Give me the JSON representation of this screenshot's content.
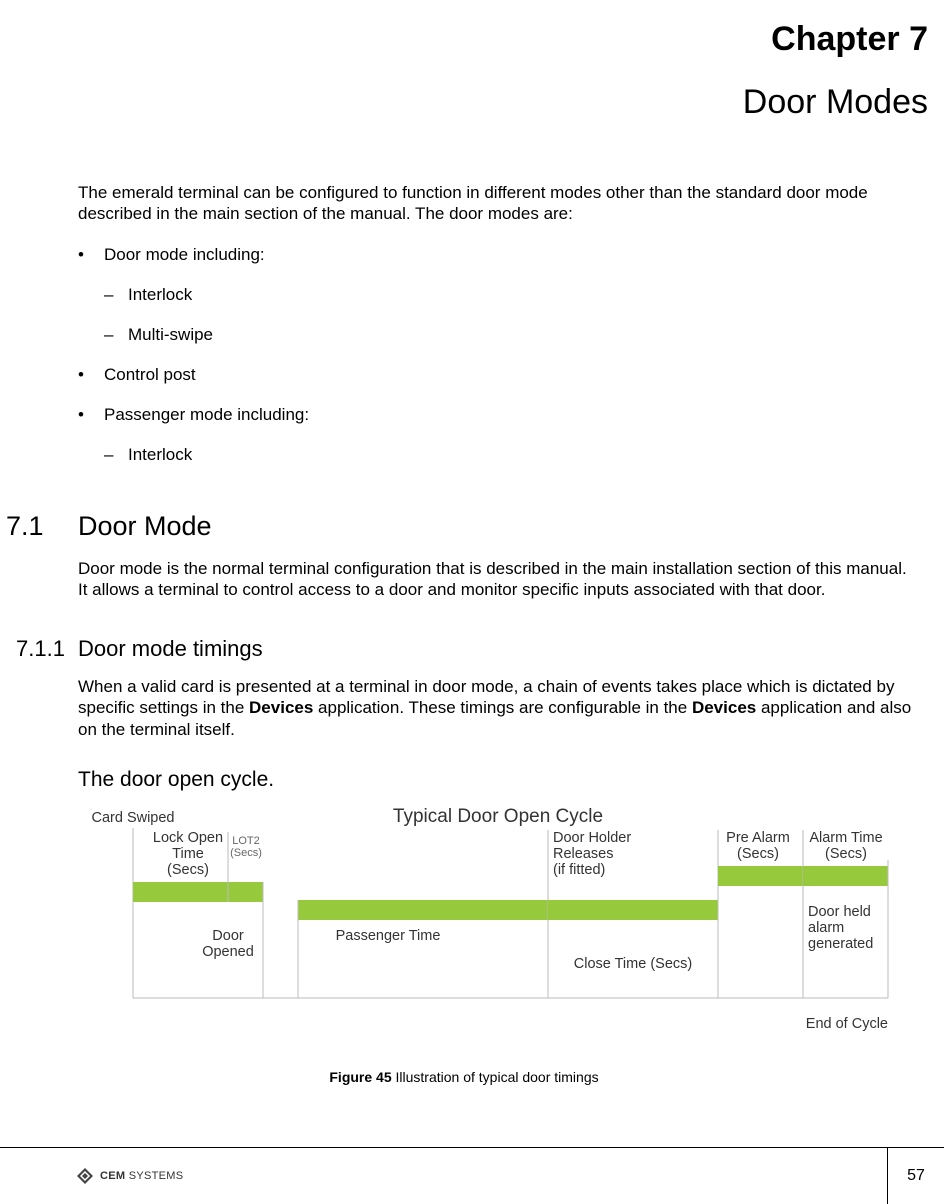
{
  "chapter": {
    "label": "Chapter 7",
    "title": "Door Modes"
  },
  "intro": "The emerald terminal can be configured to function in different modes other than the standard door mode described in the main section of the manual. The door modes are:",
  "bullets": {
    "b1": "Door mode including:",
    "b1a": "Interlock",
    "b1b": "Multi-swipe",
    "b2": "Control post",
    "b3": "Passenger mode including:",
    "b3a": "Interlock"
  },
  "section71": {
    "num": "7.1",
    "title": "Door Mode",
    "body": "Door mode is the normal terminal configuration that is described in the main installation section of this manual. It allows a terminal to control access to a door and monitor specific inputs associated with that door."
  },
  "section711": {
    "num": "7.1.1",
    "title": "Door mode timings",
    "body_pre": "When a valid card is presented at a terminal in door mode, a chain of events takes place which is dictated by specific settings in the ",
    "body_bold1": "Devices",
    "body_mid": " application. These timings are configurable in the ",
    "body_bold2": "Devices",
    "body_post": " application and also on the terminal itself."
  },
  "subhead": "The door open cycle.",
  "diagram": {
    "title": "Typical Door Open Cycle",
    "card_swiped": "Card Swiped",
    "lock_open1": "Lock Open",
    "lock_open2": "Time",
    "lock_open3": "(Secs)",
    "lot2a": "LOT2",
    "lot2b": "(Secs)",
    "door_opened1": "Door",
    "door_opened2": "Opened",
    "passenger_time": "Passenger Time",
    "holder1": "Door Holder",
    "holder2": "Releases",
    "holder3": "(if fitted)",
    "close_time": "Close Time (Secs)",
    "pre_alarm1": "Pre Alarm",
    "pre_alarm2": "(Secs)",
    "alarm_time1": "Alarm Time",
    "alarm_time2": "(Secs)",
    "door_held1": "Door held",
    "door_held2": "alarm",
    "door_held3": "generated",
    "end": "End of Cycle"
  },
  "figure": {
    "bold": "Figure 45",
    "text": " Illustration of typical door timings"
  },
  "footer": {
    "brand1": "CEM",
    "brand2": " SYSTEMS",
    "page": "57"
  }
}
